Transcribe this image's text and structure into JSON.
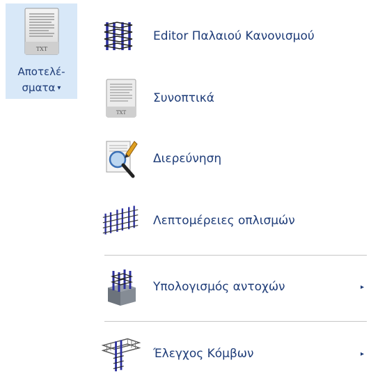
{
  "ribbon_button": {
    "icon": "txt-document-icon",
    "icon_caption": "TXT",
    "label_line1": "Αποτελέ-",
    "label_line2": "σματα",
    "dropdown_glyph": "▾"
  },
  "menu": {
    "items": [
      {
        "label": "Editor Παλαιού Κανονισμού",
        "icon": "rebar-cage-icon",
        "has_submenu": false
      },
      {
        "label": "Συνοπτικά",
        "icon": "txt-document-icon",
        "icon_caption": "TXT",
        "has_submenu": false
      },
      {
        "label": "Διερεύνηση",
        "icon": "magnifier-document-icon",
        "has_submenu": false
      },
      {
        "label": "Λεπτομέρειες οπλισμών",
        "icon": "reinforcement-details-icon",
        "has_submenu": false
      },
      {
        "label": "Υπολογισμός αντοχών",
        "icon": "column-strength-icon",
        "has_submenu": true
      },
      {
        "label": "Έλεγχος Κόμβων",
        "icon": "beam-column-joint-icon",
        "has_submenu": true
      }
    ],
    "submenu_glyph": "▸"
  },
  "colors": {
    "ribbon_bg": "#d8e8f8",
    "text": "#1e3c78",
    "separator": "#c6c6c6",
    "rebar_blue": "#2b2f9e"
  }
}
